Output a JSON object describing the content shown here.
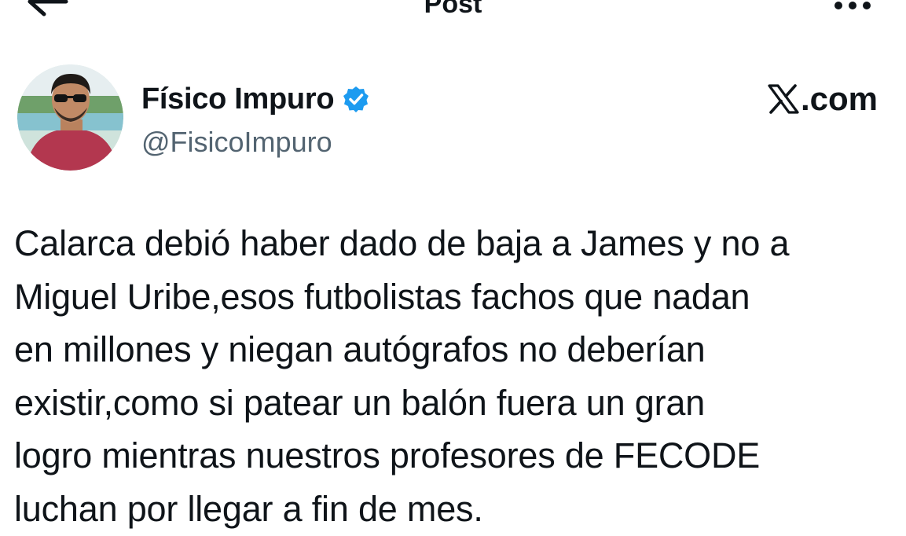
{
  "topbar": {
    "back_icon": "arrow-left-icon",
    "title": "Post",
    "more_icon": "more-horizontal-icon"
  },
  "author": {
    "display_name": "Físico Impuro",
    "verified_icon": "verified-badge-icon",
    "verified_color": "#1d9bf0",
    "handle": "@FisicoImpuro",
    "avatar_icon": "profile-avatar"
  },
  "site": {
    "logo_icon": "x-logo-icon",
    "suffix": ".com"
  },
  "post": {
    "lines": [
      "Calarca debió haber dado de baja a James y no a",
      "Miguel Uribe,esos futbolistas fachos que nadan",
      "en millones y niegan autógrafos no deberían",
      "existir,como si patear un balón fuera un gran",
      "logro mientras nuestros profesores de FECODE",
      "luchan por llegar a fin de mes."
    ]
  }
}
